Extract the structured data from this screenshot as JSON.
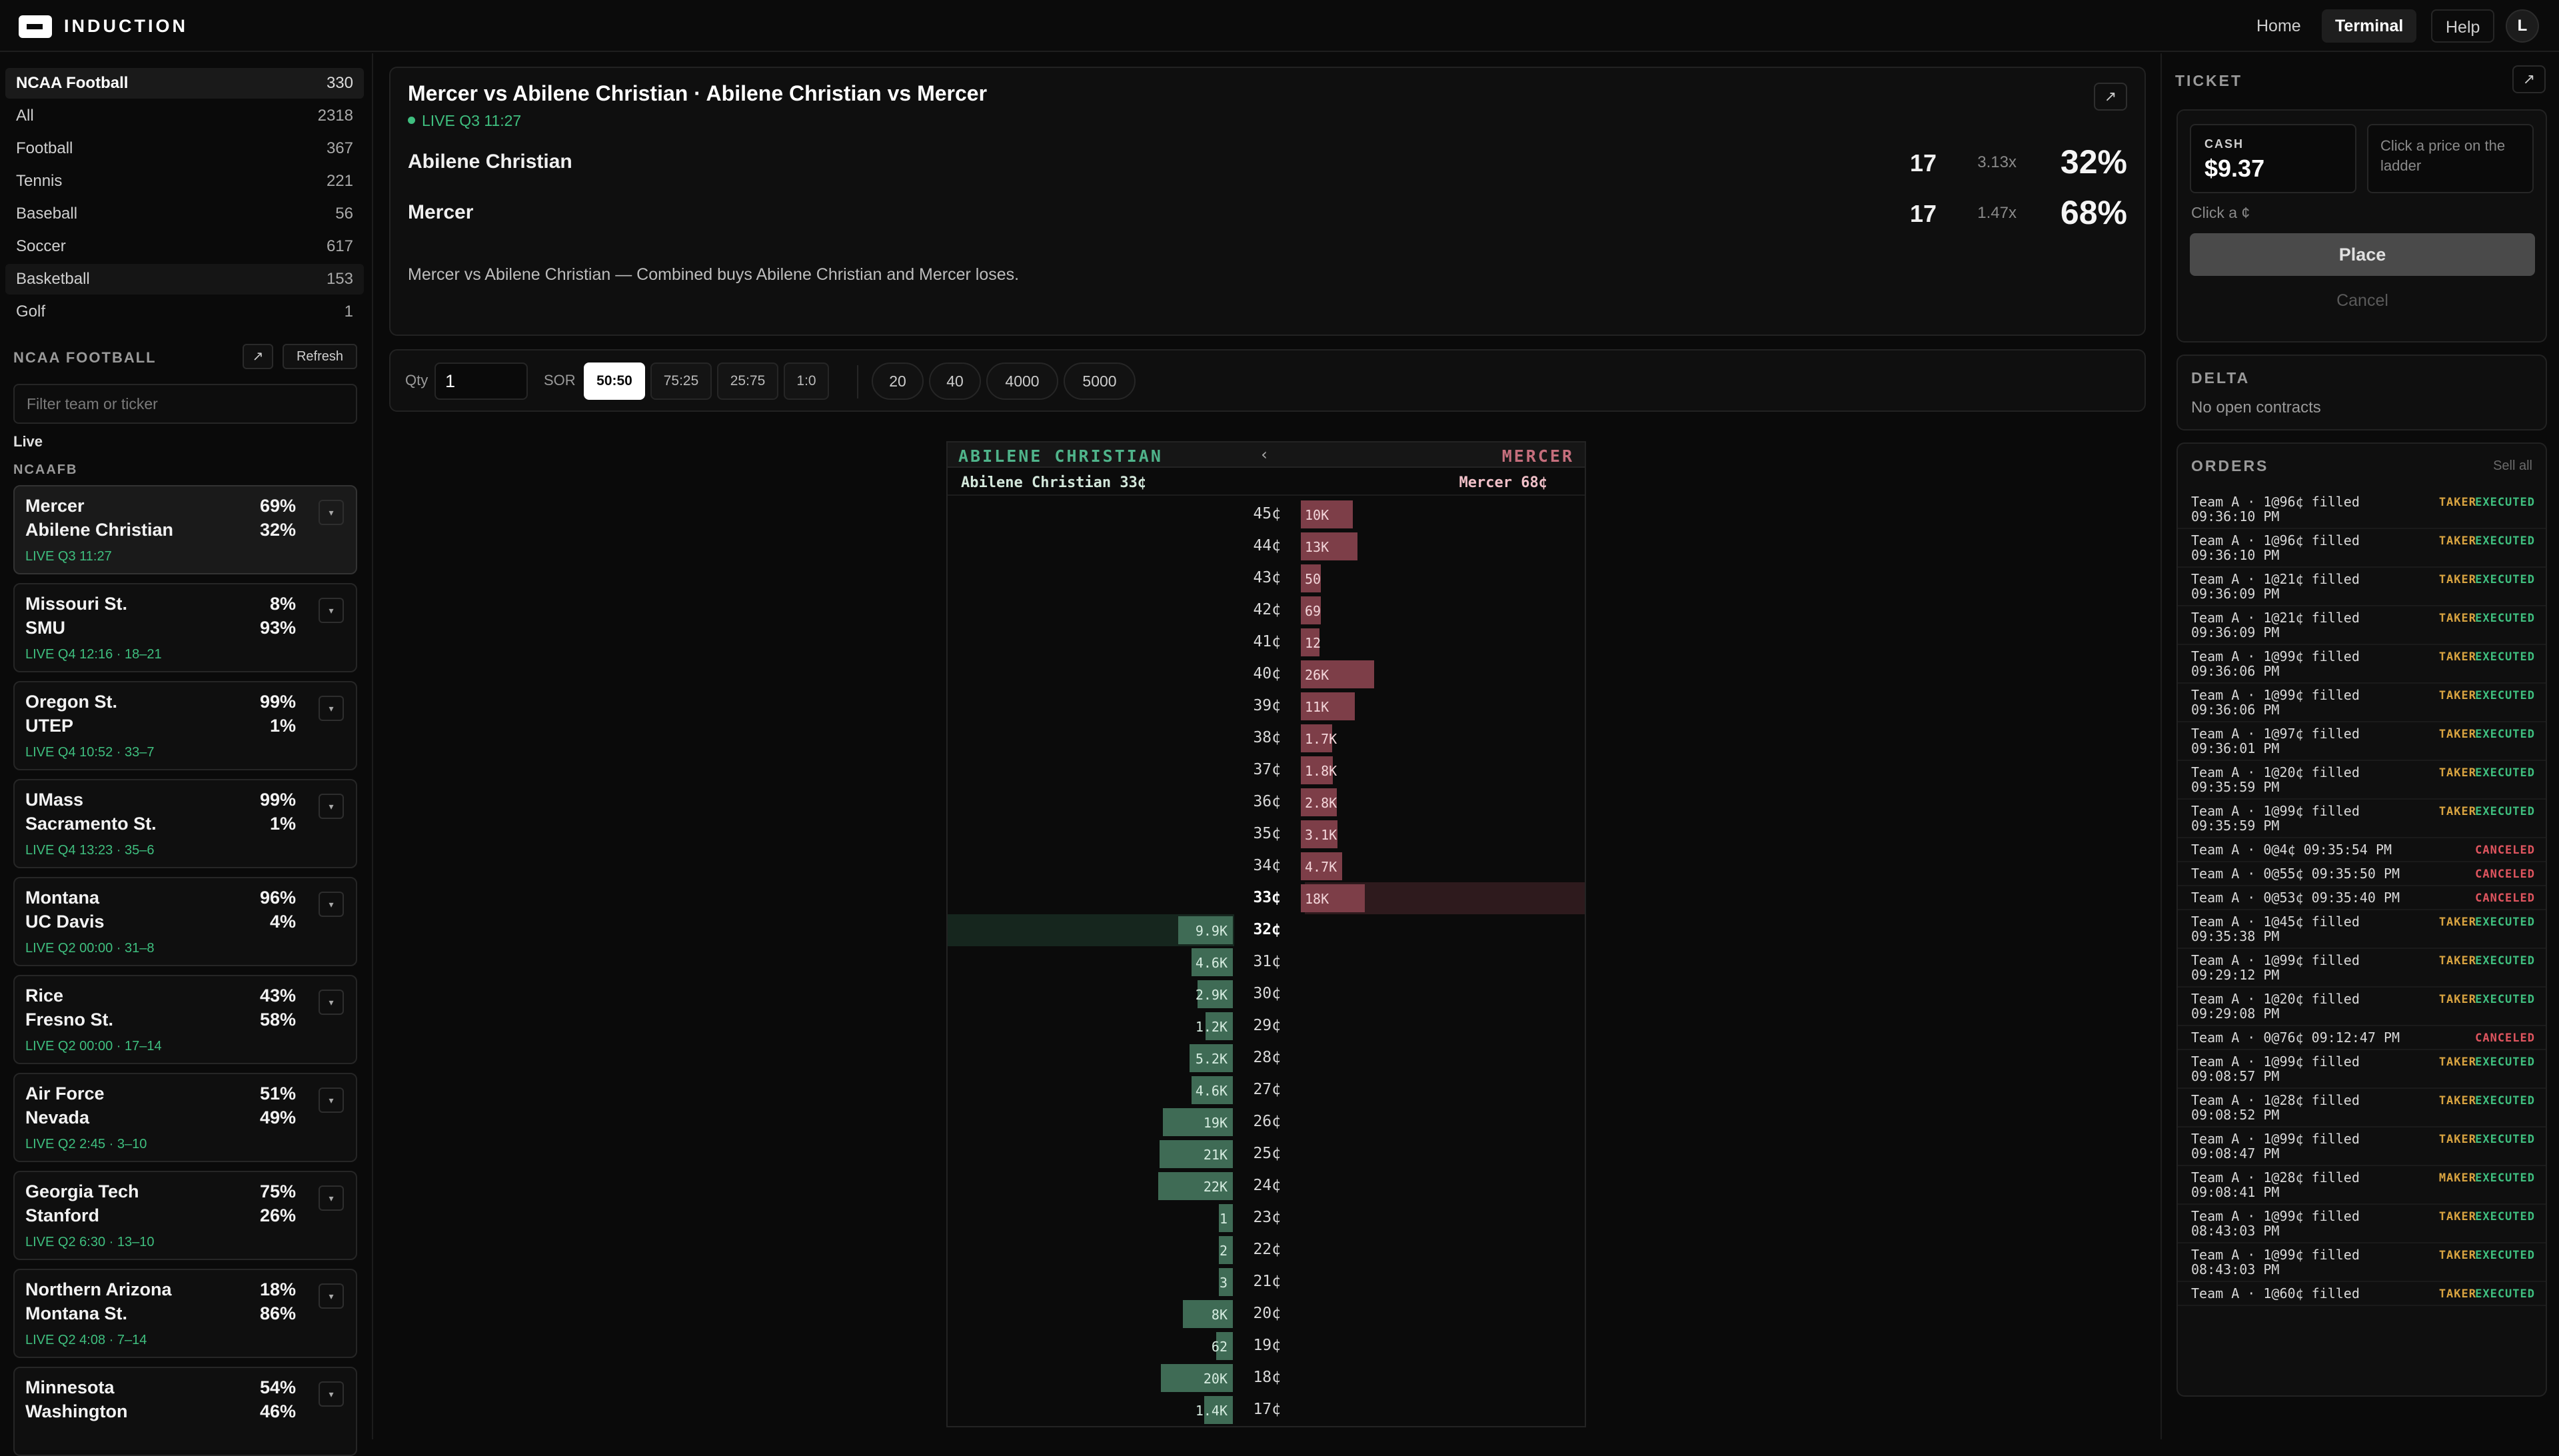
{
  "app": {
    "brand": "INDUCTION",
    "nav": [
      "Home",
      "Terminal",
      "Help"
    ],
    "active_nav": "Terminal",
    "avatar": "L"
  },
  "sidebar": {
    "sports": [
      {
        "name": "NCAA Football",
        "count": "330",
        "selected": true
      },
      {
        "name": "All",
        "count": "2318"
      },
      {
        "name": "Football",
        "count": "367"
      },
      {
        "name": "Tennis",
        "count": "221"
      },
      {
        "name": "Baseball",
        "count": "56"
      },
      {
        "name": "Soccer",
        "count": "617"
      },
      {
        "name": "Basketball",
        "count": "153",
        "highlight": true
      },
      {
        "name": "Golf",
        "count": "1"
      }
    ],
    "section_title": "NCAA FOOTBALL",
    "refresh": "Refresh",
    "filter_placeholder": "Filter team or ticker",
    "live_label": "Live",
    "league_label": "NCAAFB",
    "games": [
      {
        "t1": "Mercer",
        "p1": "69%",
        "t2": "Abilene Christian",
        "p2": "32%",
        "status": "LIVE Q3 11:27",
        "selected": true
      },
      {
        "t1": "Missouri St.",
        "p1": "8%",
        "t2": "SMU",
        "p2": "93%",
        "status": "LIVE Q4 12:16 · 18–21"
      },
      {
        "t1": "Oregon St.",
        "p1": "99%",
        "t2": "UTEP",
        "p2": "1%",
        "status": "LIVE Q4 10:52 · 33–7"
      },
      {
        "t1": "UMass",
        "p1": "99%",
        "t2": "Sacramento St.",
        "p2": "1%",
        "status": "LIVE Q4 13:23 · 35–6"
      },
      {
        "t1": "Montana",
        "p1": "96%",
        "t2": "UC Davis",
        "p2": "4%",
        "status": "LIVE Q2 00:00 · 31–8"
      },
      {
        "t1": "Rice",
        "p1": "43%",
        "t2": "Fresno St.",
        "p2": "58%",
        "status": "LIVE Q2 00:00 · 17–14"
      },
      {
        "t1": "Air Force",
        "p1": "51%",
        "t2": "Nevada",
        "p2": "49%",
        "status": "LIVE Q2 2:45 · 3–10"
      },
      {
        "t1": "Georgia Tech",
        "p1": "75%",
        "t2": "Stanford",
        "p2": "26%",
        "status": "LIVE Q2 6:30 · 13–10"
      },
      {
        "t1": "Northern Arizona",
        "p1": "18%",
        "t2": "Montana St.",
        "p2": "86%",
        "status": "LIVE Q2 4:08 · 7–14"
      },
      {
        "t1": "Minnesota",
        "p1": "54%",
        "t2": "Washington",
        "p2": "46%",
        "status": ""
      }
    ]
  },
  "match": {
    "title": "Mercer vs Abilene Christian · Abilene Christian vs Mercer",
    "status": "LIVE Q3 11:27",
    "teams": [
      {
        "name": "Abilene Christian",
        "score": "17",
        "mult": "3.13x",
        "prob": "32%"
      },
      {
        "name": "Mercer",
        "score": "17",
        "mult": "1.47x",
        "prob": "68%"
      }
    ],
    "description": "Mercer vs Abilene Christian — Combined buys Abilene Christian and Mercer loses."
  },
  "controls": {
    "qty_label": "Qty",
    "qty_value": "1",
    "sor_label": "SOR",
    "ratios": [
      "50:50",
      "75:25",
      "25:75",
      "1:0"
    ],
    "active_ratio": "50:50",
    "chips": [
      "20",
      "40",
      "4000",
      "5000"
    ]
  },
  "ladder": {
    "left_team": "ABILENE CHRISTIAN",
    "right_team": "MERCER",
    "arrow": "‹",
    "left_quote": "Abilene Christian 33¢",
    "right_quote": "Mercer 68¢",
    "rows": [
      {
        "price": "45¢",
        "ask": "10K",
        "askv": 10000
      },
      {
        "price": "44¢",
        "ask": "13K",
        "askv": 13000
      },
      {
        "price": "43¢",
        "ask": "50",
        "askv": 50
      },
      {
        "price": "42¢",
        "ask": "69",
        "askv": 69
      },
      {
        "price": "41¢",
        "ask": "12",
        "askv": 12
      },
      {
        "price": "40¢",
        "ask": "26K",
        "askv": 26000
      },
      {
        "price": "39¢",
        "ask": "11K",
        "askv": 11000
      },
      {
        "price": "38¢",
        "ask": "1.7K",
        "askv": 1700
      },
      {
        "price": "37¢",
        "ask": "1.8K",
        "askv": 1800
      },
      {
        "price": "36¢",
        "ask": "2.8K",
        "askv": 2800
      },
      {
        "price": "35¢",
        "ask": "3.1K",
        "askv": 3100
      },
      {
        "price": "34¢",
        "ask": "4.7K",
        "askv": 4700
      },
      {
        "price": "33¢",
        "ask": "18K",
        "askv": 18000,
        "best_ask": true
      },
      {
        "price": "32¢",
        "bid": "9.9K",
        "bidv": 9900,
        "best_bid": true
      },
      {
        "price": "31¢",
        "bid": "4.6K",
        "bidv": 4600
      },
      {
        "price": "30¢",
        "bid": "2.9K",
        "bidv": 2900
      },
      {
        "price": "29¢",
        "bid": "1.2K",
        "bidv": 1200
      },
      {
        "price": "28¢",
        "bid": "5.2K",
        "bidv": 5200
      },
      {
        "price": "27¢",
        "bid": "4.6K",
        "bidv": 4600
      },
      {
        "price": "26¢",
        "bid": "19K",
        "bidv": 19000
      },
      {
        "price": "25¢",
        "bid": "21K",
        "bidv": 21000
      },
      {
        "price": "24¢",
        "bid": "22K",
        "bidv": 22000
      },
      {
        "price": "23¢",
        "bid": "1",
        "bidv": 1
      },
      {
        "price": "22¢",
        "bid": "2",
        "bidv": 2
      },
      {
        "price": "21¢",
        "bid": "3",
        "bidv": 3
      },
      {
        "price": "20¢",
        "bid": "8K",
        "bidv": 8000
      },
      {
        "price": "19¢",
        "bid": "62",
        "bidv": 62
      },
      {
        "price": "18¢",
        "bid": "20K",
        "bidv": 20000
      },
      {
        "price": "17¢",
        "bid": "1.4K",
        "bidv": 1400
      }
    ]
  },
  "ticket": {
    "title": "TICKET",
    "cash_label": "CASH",
    "cash_value": "$9.37",
    "hint": "Click a price on the ladder",
    "click_label": "Click a ¢",
    "place": "Place",
    "cancel": "Cancel"
  },
  "delta": {
    "title": "DELTA",
    "text": "No open contracts"
  },
  "orders": {
    "title": "ORDERS",
    "sell_all": "Sell all",
    "items": [
      {
        "text": "Team A · 1@96¢ filled 09:36:10 PM",
        "role": "TAKER",
        "status": "EXECUTED"
      },
      {
        "text": "Team A · 1@96¢ filled 09:36:10 PM",
        "role": "TAKER",
        "status": "EXECUTED"
      },
      {
        "text": "Team A · 1@21¢ filled 09:36:09 PM",
        "role": "TAKER",
        "status": "EXECUTED"
      },
      {
        "text": "Team A · 1@21¢ filled 09:36:09 PM",
        "role": "TAKER",
        "status": "EXECUTED"
      },
      {
        "text": "Team A · 1@99¢ filled 09:36:06 PM",
        "role": "TAKER",
        "status": "EXECUTED"
      },
      {
        "text": "Team A · 1@99¢ filled 09:36:06 PM",
        "role": "TAKER",
        "status": "EXECUTED"
      },
      {
        "text": "Team A · 1@97¢ filled 09:36:01 PM",
        "role": "TAKER",
        "status": "EXECUTED"
      },
      {
        "text": "Team A · 1@20¢ filled 09:35:59 PM",
        "role": "TAKER",
        "status": "EXECUTED"
      },
      {
        "text": "Team A · 1@99¢ filled 09:35:59 PM",
        "role": "TAKER",
        "status": "EXECUTED"
      },
      {
        "text": "Team A · 0@4¢ 09:35:54 PM",
        "role": "",
        "status": "CANCELED"
      },
      {
        "text": "Team A · 0@55¢ 09:35:50 PM",
        "role": "",
        "status": "CANCELED"
      },
      {
        "text": "Team A · 0@53¢ 09:35:40 PM",
        "role": "",
        "status": "CANCELED"
      },
      {
        "text": "Team A · 1@45¢ filled 09:35:38 PM",
        "role": "TAKER",
        "status": "EXECUTED"
      },
      {
        "text": "Team A · 1@99¢ filled 09:29:12 PM",
        "role": "TAKER",
        "status": "EXECUTED"
      },
      {
        "text": "Team A · 1@20¢ filled 09:29:08 PM",
        "role": "TAKER",
        "status": "EXECUTED"
      },
      {
        "text": "Team A · 0@76¢ 09:12:47 PM",
        "role": "",
        "status": "CANCELED"
      },
      {
        "text": "Team A · 1@99¢ filled 09:08:57 PM",
        "role": "TAKER",
        "status": "EXECUTED"
      },
      {
        "text": "Team A · 1@28¢ filled 09:08:52 PM",
        "role": "TAKER",
        "status": "EXECUTED"
      },
      {
        "text": "Team A · 1@99¢ filled 09:08:47 PM",
        "role": "TAKER",
        "status": "EXECUTED"
      },
      {
        "text": "Team A · 1@28¢ filled 09:08:41 PM",
        "role": "MAKER",
        "status": "EXECUTED"
      },
      {
        "text": "Team A · 1@99¢ filled 08:43:03 PM",
        "role": "TAKER",
        "status": "EXECUTED"
      },
      {
        "text": "Team A · 1@99¢ filled 08:43:03 PM",
        "role": "TAKER",
        "status": "EXECUTED"
      },
      {
        "text": "Team A · 1@60¢ filled",
        "role": "TAKER",
        "status": "EXECUTED"
      }
    ]
  }
}
